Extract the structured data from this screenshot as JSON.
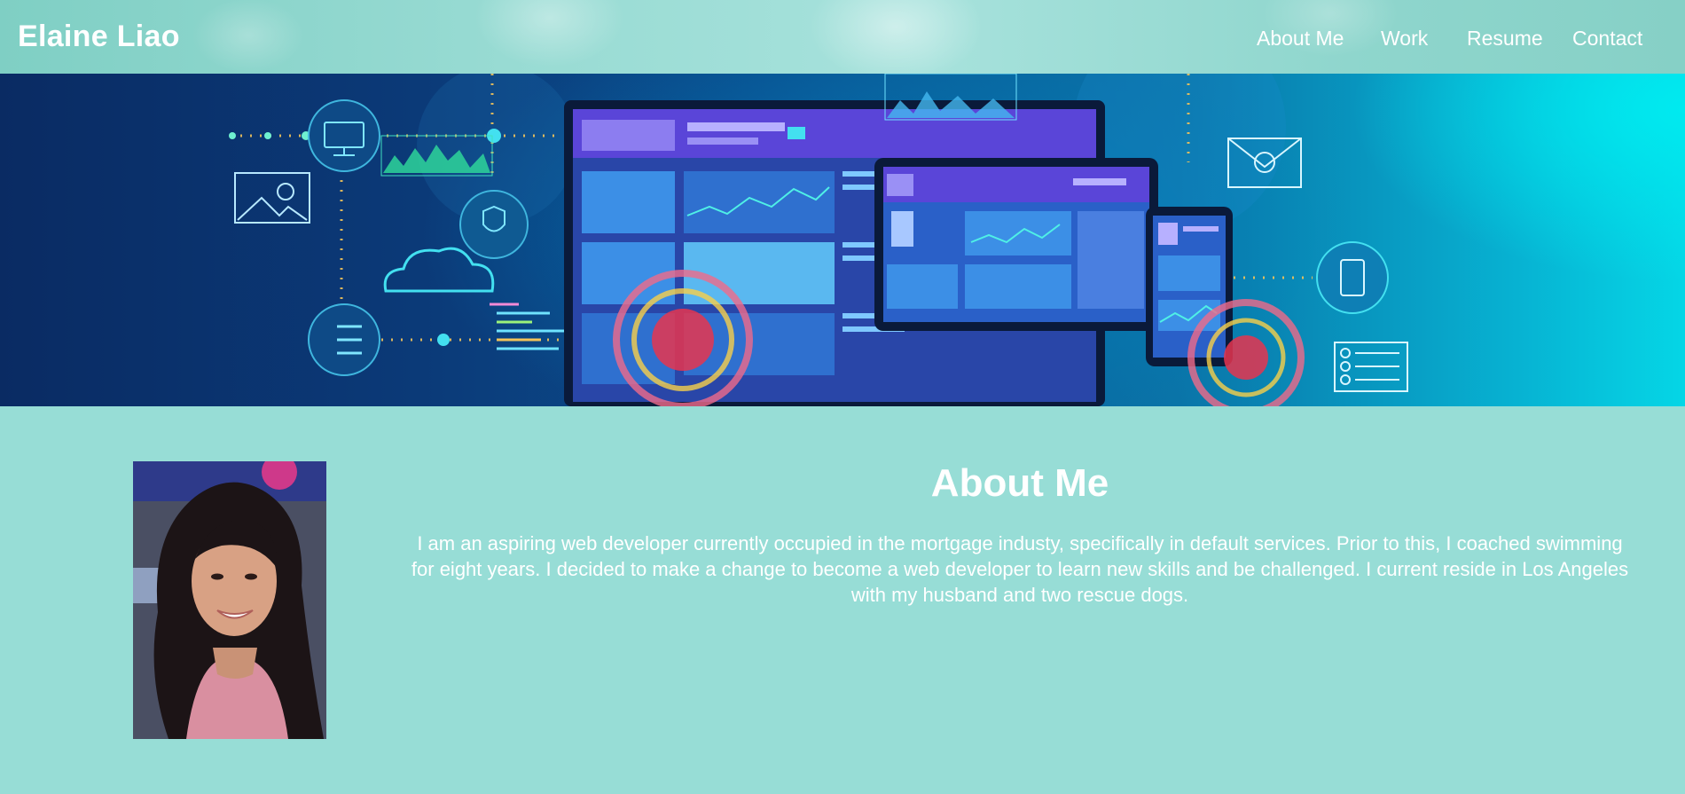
{
  "site": {
    "brand": "Elaine Liao"
  },
  "nav": {
    "items": [
      {
        "label": "About Me"
      },
      {
        "label": "Work"
      },
      {
        "label": "Resume"
      },
      {
        "label": "Contact"
      }
    ]
  },
  "about": {
    "title": "About Me",
    "text": "I am an aspiring web developer currently occupied in the mortgage industy, specifically in default services. Prior to this, I coached swimming for eight years. I decided to make a change to become a web developer to learn new skills and be challenged. I current reside in Los Angeles with my husband and two rescue dogs."
  },
  "colors": {
    "background": "#97ddd6",
    "text": "#ffffff"
  }
}
